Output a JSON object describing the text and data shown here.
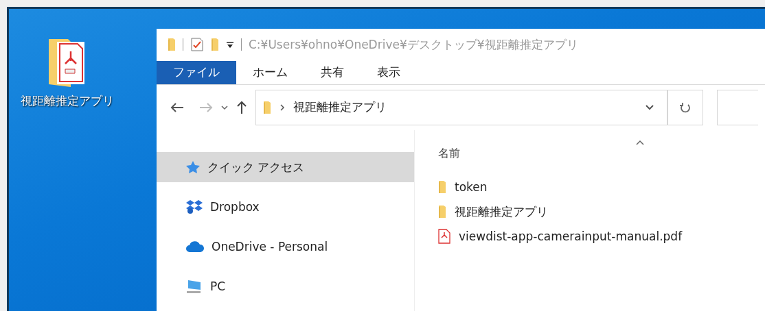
{
  "desktop_icons": [
    {
      "label": "視距離推定アプリ",
      "kind": "pdf-folder"
    }
  ],
  "window": {
    "title_path": "C:¥Users¥ohno¥OneDrive¥デスクトップ¥視距離推定アプリ"
  },
  "ribbon_tabs": [
    {
      "label": "ファイル",
      "selected": true
    },
    {
      "label": "ホーム",
      "selected": false
    },
    {
      "label": "共有",
      "selected": false
    },
    {
      "label": "表示",
      "selected": false
    }
  ],
  "address_bar": {
    "path": "視距離推定アプリ"
  },
  "navigation_pane": [
    {
      "label": "クイック アクセス",
      "kind": "star",
      "selected": true
    },
    {
      "label": "Dropbox",
      "kind": "dropbox",
      "selected": false
    },
    {
      "label": "OneDrive - Personal",
      "kind": "cloud",
      "selected": false
    },
    {
      "label": "PC",
      "kind": "pc",
      "selected": false
    }
  ],
  "file_list": {
    "column": "名前",
    "items": [
      {
        "name": "token",
        "kind": "folder"
      },
      {
        "name": "視距離推定アプリ",
        "kind": "folder"
      },
      {
        "name": "viewdist-app-camerainput-manual.pdf",
        "kind": "pdf"
      }
    ]
  }
}
